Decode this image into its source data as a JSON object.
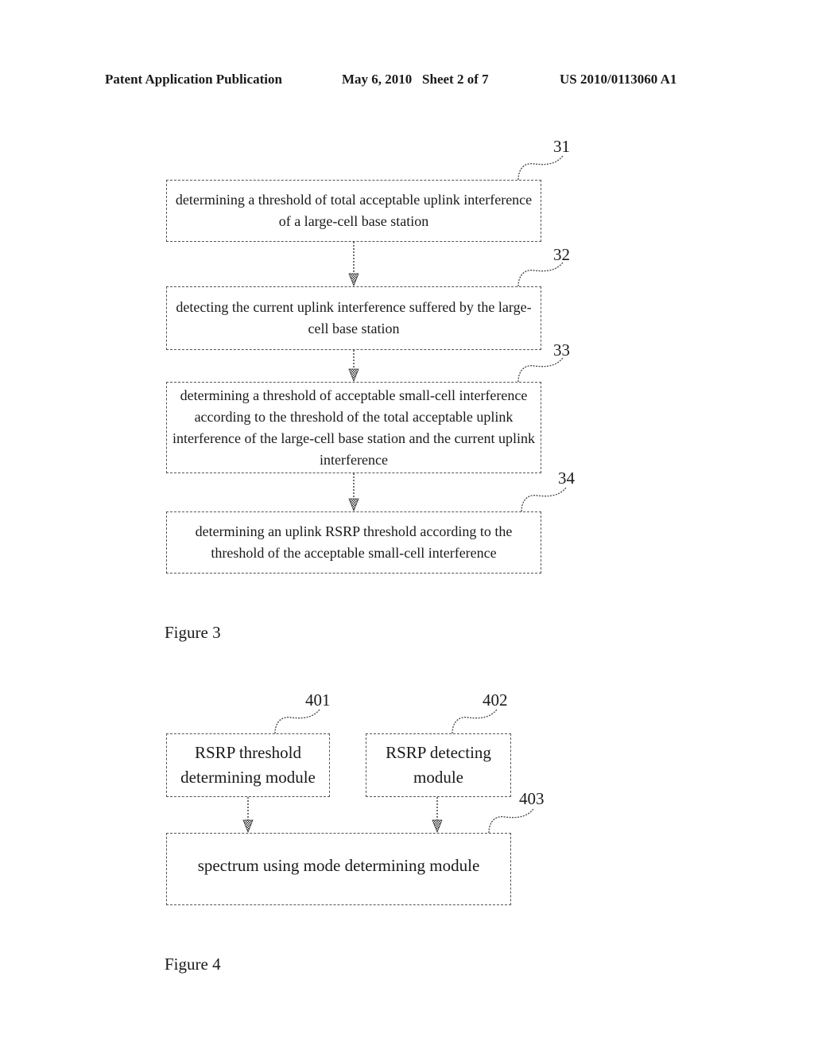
{
  "header": {
    "publication": "Patent Application Publication",
    "date_sheet": "May 6, 2010   Sheet 2 of 7",
    "number": "US 2010/0113060 A1"
  },
  "figure3": {
    "label": "Figure 3",
    "steps": [
      {
        "ref": "31",
        "text": "determining a threshold of total acceptable uplink interference of a large-cell base station"
      },
      {
        "ref": "32",
        "text": "detecting the current uplink interference suffered by the large-cell base station"
      },
      {
        "ref": "33",
        "text": "determining a threshold of acceptable small-cell interference according to the threshold of the total acceptable uplink interference of the large-cell base station and the current uplink interference"
      },
      {
        "ref": "34",
        "text": "determining an uplink RSRP threshold according to the threshold of the acceptable small-cell interference"
      }
    ]
  },
  "figure4": {
    "label": "Figure 4",
    "modules": [
      {
        "ref": "401",
        "text": "RSRP threshold determining module"
      },
      {
        "ref": "402",
        "text": "RSRP detecting module"
      },
      {
        "ref": "403",
        "text": "spectrum using mode determining module"
      }
    ]
  }
}
